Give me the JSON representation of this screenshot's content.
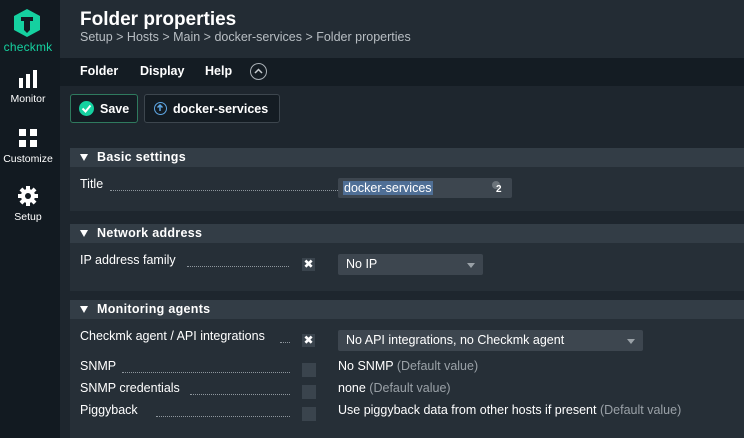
{
  "sidebar": {
    "logo_text": "checkmk",
    "items": [
      {
        "label": "Monitor",
        "icon": "bar-chart-icon"
      },
      {
        "label": "Customize",
        "icon": "grid-icon"
      },
      {
        "label": "Setup",
        "icon": "gear-icon"
      }
    ]
  },
  "header": {
    "title": "Folder properties",
    "breadcrumb": "Setup > Hosts > Main > docker-services > Folder properties"
  },
  "menu": {
    "items": [
      "Folder",
      "Display",
      "Help"
    ]
  },
  "toolbar": {
    "save_label": "Save",
    "folder_label": "docker-services"
  },
  "sections": {
    "basic": {
      "title": "Basic settings",
      "title_label": "Title",
      "title_value": "docker-services",
      "title_badge": "2"
    },
    "network": {
      "title": "Network address",
      "ip_label": "IP address family",
      "ip_value": "No IP"
    },
    "agents": {
      "title": "Monitoring agents",
      "agent_label": "Checkmk agent / API integrations",
      "agent_value": "No API integrations, no Checkmk agent",
      "snmp_label": "SNMP",
      "snmp_value": "No SNMP",
      "snmp_default": "(Default value)",
      "snmp_cred_label": "SNMP credentials",
      "snmp_cred_value": "none",
      "snmp_cred_default": "(Default value)",
      "piggyback_label": "Piggyback",
      "piggyback_value": "Use piggyback data from other hosts if present",
      "piggyback_default": "(Default value)"
    }
  },
  "colors": {
    "accent": "#15d1a0",
    "sidebar_bg": "#121a21",
    "page_bg": "#1e262e",
    "selection": "#4f6f96"
  }
}
